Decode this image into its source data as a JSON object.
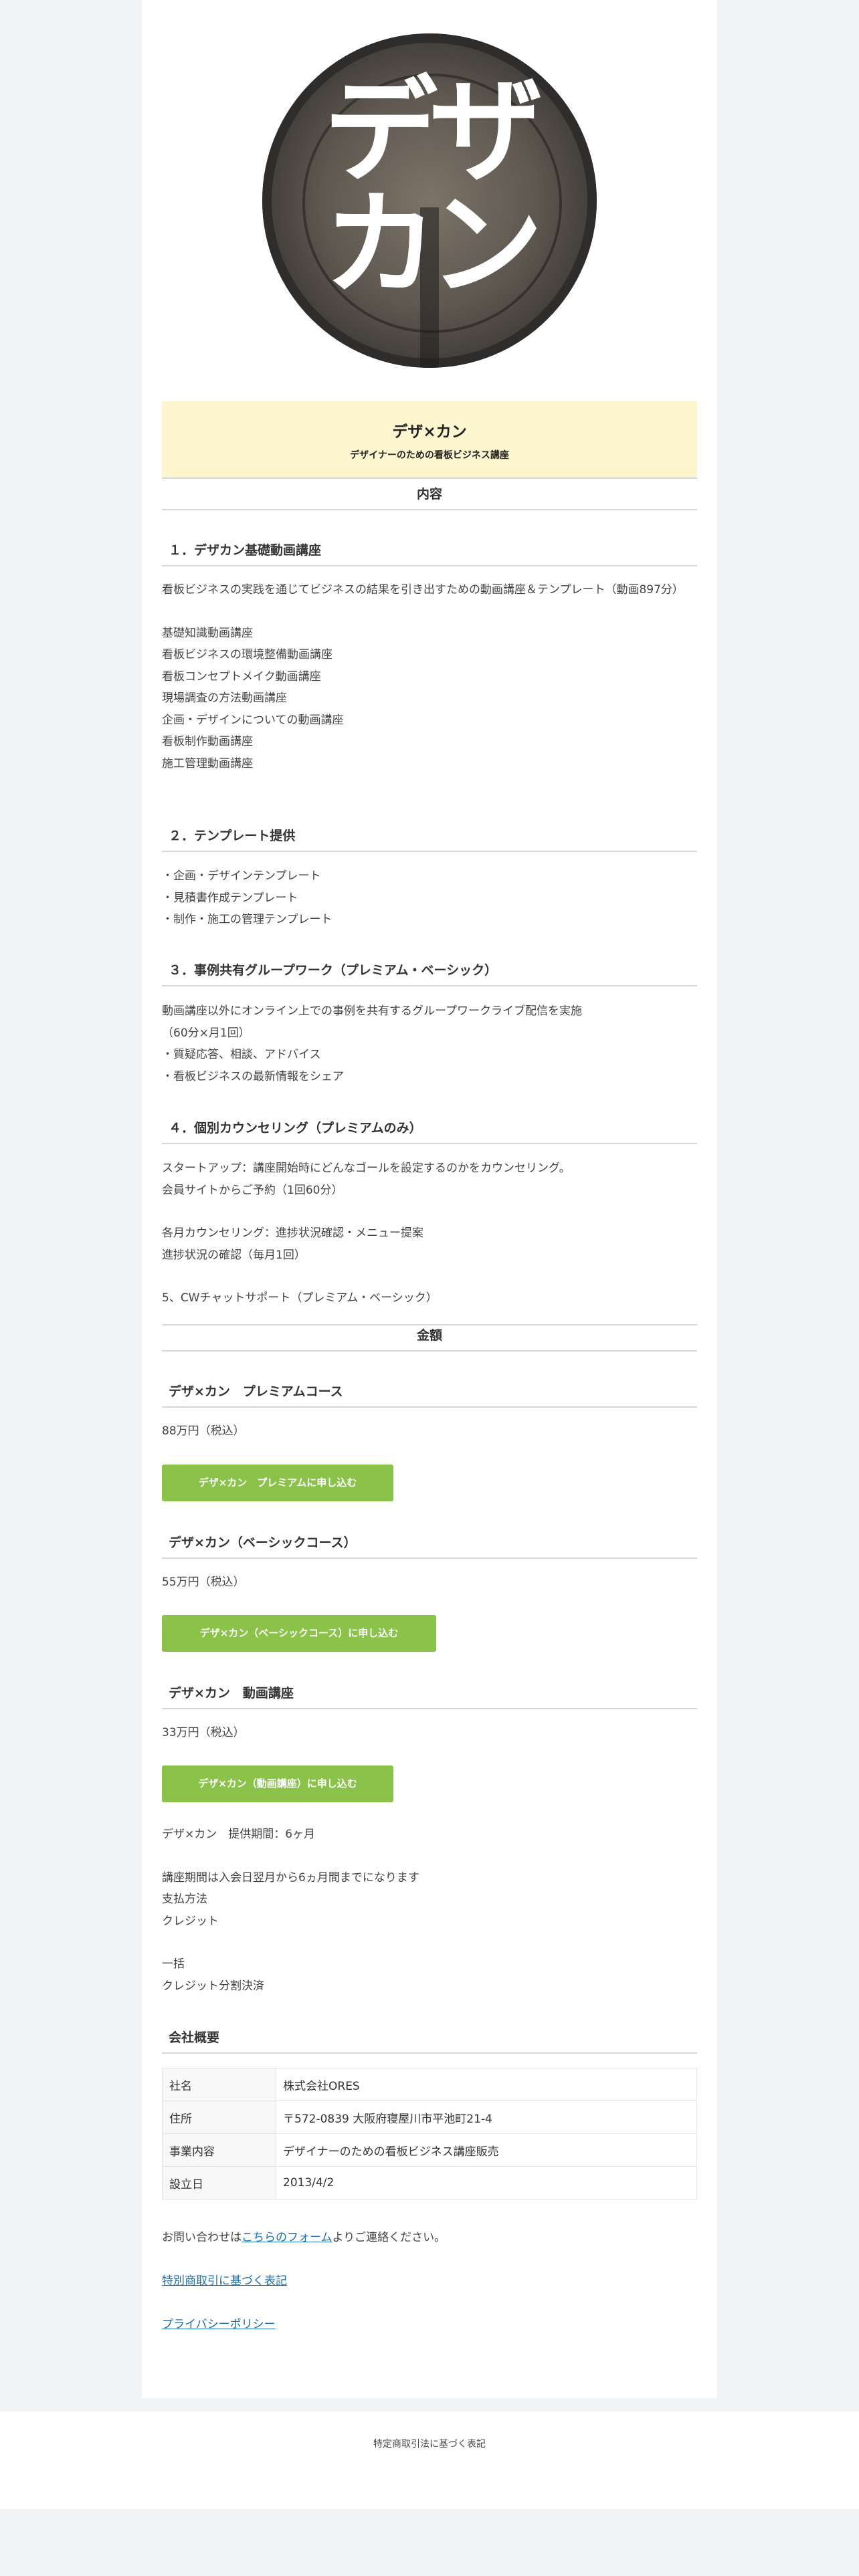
{
  "logo": {
    "line1": "デザ",
    "line2": "カン"
  },
  "hero": {
    "title": "デザ×カン",
    "subtitle": "デザイナーのための看板ビジネス講座"
  },
  "contents": {
    "section_title": "内容",
    "s1": {
      "title": "１．デザカン基礎動画講座",
      "intro": "看板ビジネスの実践を通じてビジネスの結果を引き出すための動画講座＆テンプレート（動画897分）",
      "items": [
        "基礎知識動画講座",
        "看板ビジネスの環境整備動画講座",
        "看板コンセプトメイク動画講座",
        "現場調査の方法動画講座",
        "企画・デザインについての動画講座",
        "看板制作動画講座",
        "施工管理動画講座"
      ]
    },
    "s2": {
      "title": "２．テンプレート提供",
      "items": [
        "・企画・デザインテンプレート",
        "・見積書作成テンプレート",
        "・制作・施工の管理テンプレート"
      ]
    },
    "s3": {
      "title": "３．事例共有グループワーク（プレミアム・ベーシック）",
      "items": [
        "動画講座以外にオンライン上での事例を共有するグループワークライブ配信を実施",
        "（60分×月1回）",
        "・質疑応答、相談、アドバイス",
        "・看板ビジネスの最新情報をシェア"
      ]
    },
    "s4": {
      "title": "４．個別カウンセリング（プレミアムのみ）",
      "items": [
        "スタートアップ：講座開始時にどんなゴールを設定するのかをカウンセリング。",
        "会員サイトからご予約（1回60分）",
        "各月カウンセリング：進捗状況確認・メニュー提案",
        "進捗状況の確認（毎月1回）"
      ],
      "s5": "5、CWチャットサポート（プレミアム・ベーシック）"
    }
  },
  "pricing": {
    "section_title": "金額",
    "courses": [
      {
        "title": "デザ×カン　プレミアムコース",
        "price": "88万円（税込）",
        "button": "デザ×カン　プレミアムに申し込む"
      },
      {
        "title": "デザ×カン（ベーシックコース）",
        "price": "55万円（税込）",
        "button": "デザ×カン（ベーシックコース）に申し込む"
      },
      {
        "title": "デザ×カン　動画講座",
        "price": "33万円（税込）",
        "button": "デザ×カン（動画講座）に申し込む"
      }
    ],
    "notes": [
      "デザ×カン　提供期間：6ヶ月",
      "講座期間は入会日翌月から6ヵ月間までになります",
      "支払方法",
      "クレジット",
      "一括",
      "クレジット分割決済"
    ]
  },
  "company": {
    "title": "会社概要",
    "rows": [
      {
        "k": "社名",
        "v": "株式会社ORES"
      },
      {
        "k": "住所",
        "v": "〒572-0839 大阪府寝屋川市平池町21-4"
      },
      {
        "k": "事業内容",
        "v": "デザイナーのための看板ビジネス講座販売"
      },
      {
        "k": "設立日",
        "v": "2013/4/2"
      }
    ]
  },
  "contact": {
    "prefix": "お問い合わせは",
    "link": "こちらのフォーム",
    "suffix": "よりご連絡ください。",
    "tokusho": "特別商取引に基づく表記",
    "privacy": "プライバシーポリシー"
  },
  "footer": {
    "text": "特定商取引法に基づく表記"
  },
  "colors": {
    "button": "#8bc34a",
    "hero_bg": "#fdf6cf",
    "link": "#1a6fb0"
  }
}
